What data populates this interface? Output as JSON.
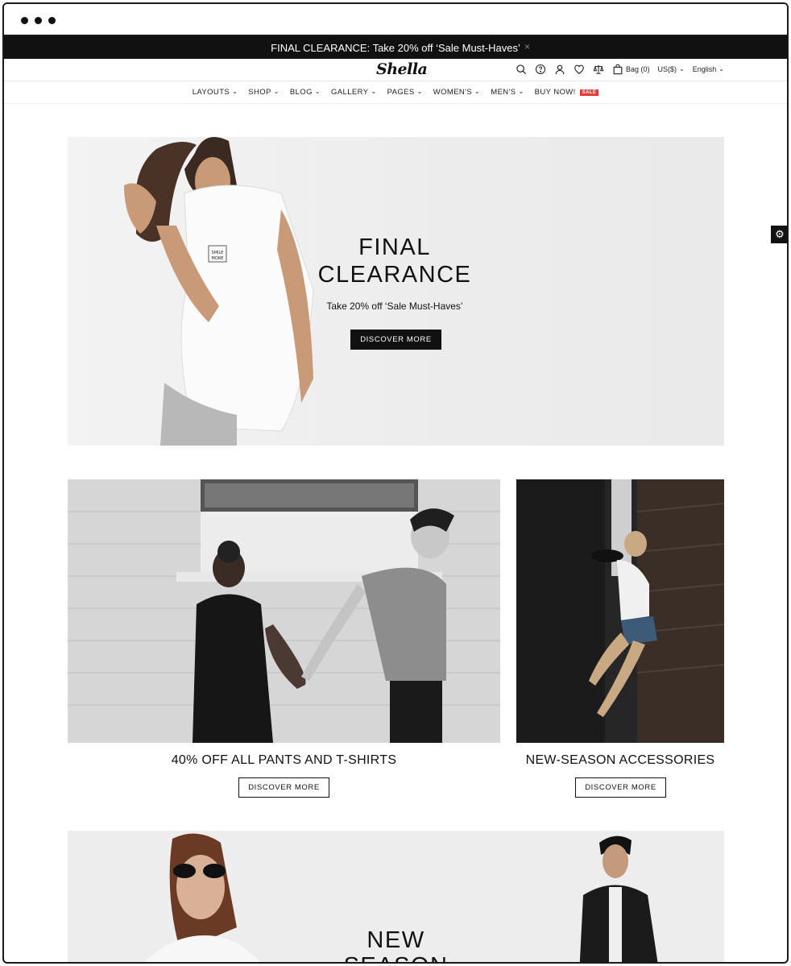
{
  "promo_bar": {
    "text": "FINAL CLEARANCE: Take 20% off ‘Sale Must-Haves’",
    "close": "×"
  },
  "header": {
    "logo": "Shella",
    "icons": [
      "search-icon",
      "help-icon",
      "user-icon",
      "heart-icon",
      "compare-icon",
      "bag-icon"
    ],
    "bag_label": "Bag (0)",
    "currency": "US($)",
    "language": "English"
  },
  "nav": {
    "items": [
      {
        "label": "LAYOUTS"
      },
      {
        "label": "SHOP"
      },
      {
        "label": "BLOG"
      },
      {
        "label": "GALLERY"
      },
      {
        "label": "PAGES"
      },
      {
        "label": "WOMEN'S"
      },
      {
        "label": "MEN'S"
      }
    ],
    "buy_now": "BUY NOW!",
    "sale_badge": "SALE"
  },
  "hero": {
    "title_line1": "FINAL",
    "title_line2": "CLEARANCE",
    "subtitle": "Take 20% off ‘Sale Must-Haves’",
    "button": "DISCOVER MORE"
  },
  "promos": [
    {
      "caption": "40% OFF ALL PANTS AND T-SHIRTS",
      "button": "DISCOVER MORE"
    },
    {
      "caption": "NEW-SEASON ACCESSORIES",
      "button": "DISCOVER MORE"
    }
  ],
  "bottom_banner": {
    "title_line1": "NEW",
    "title_line2": "SEASON"
  },
  "colors": {
    "promo_bg": "#111111",
    "sale_badge": "#e53935",
    "accent_text": "#111111"
  }
}
